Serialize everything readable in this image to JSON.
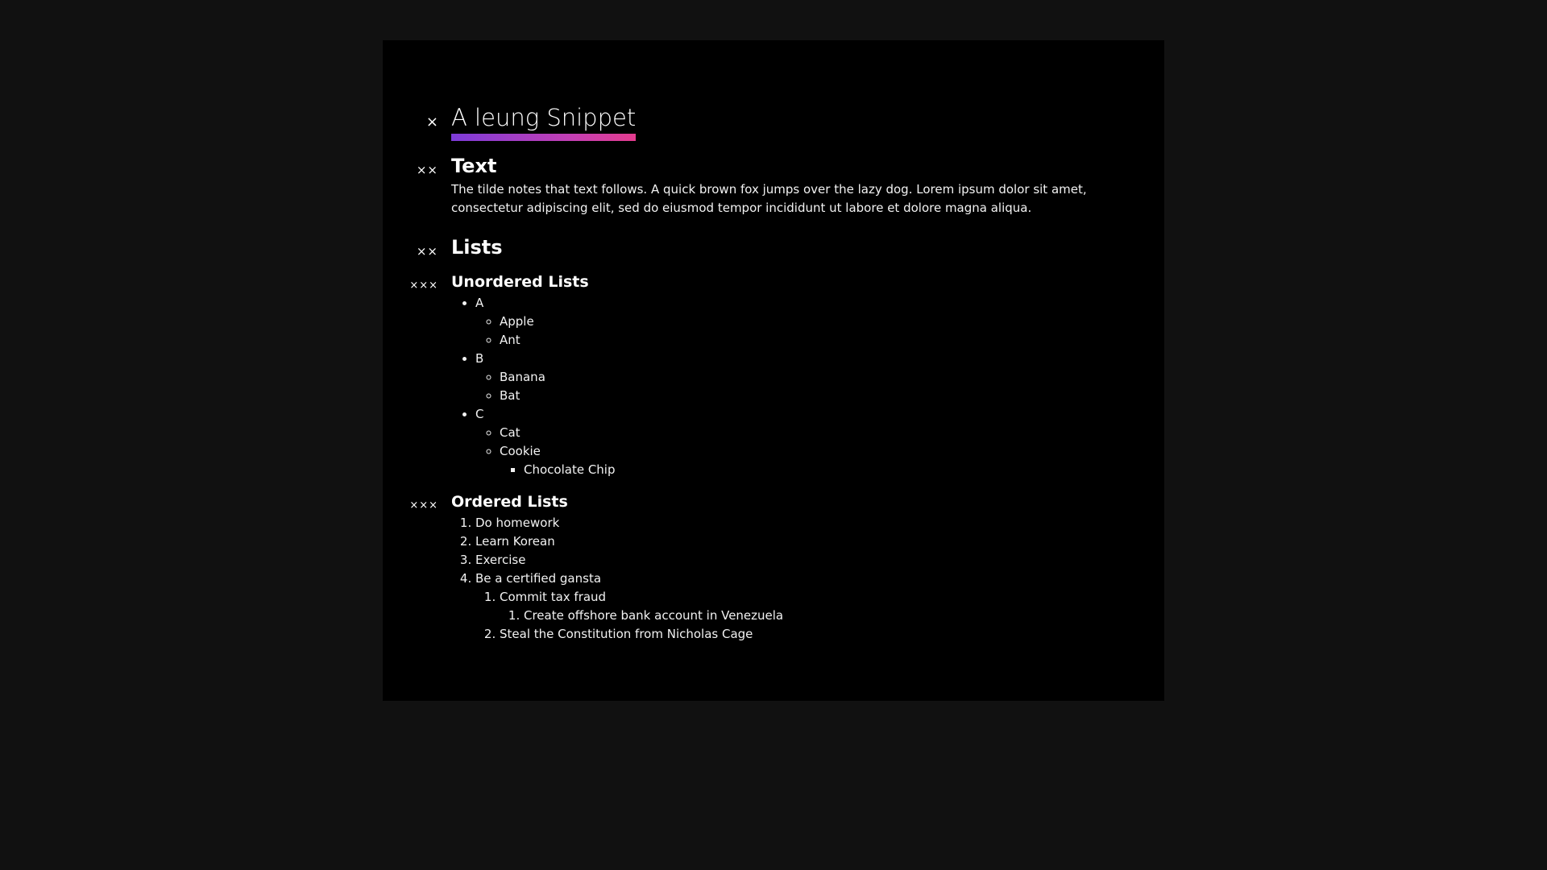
{
  "document": {
    "title": {
      "marker": "×",
      "text": "A leung Snippet"
    },
    "text_section": {
      "marker": "××",
      "heading": "Text",
      "paragraph": "The tilde notes that text follows. A quick brown fox jumps over the lazy dog. Lorem ipsum dolor sit amet, consectetur adipiscing elit, sed do eiusmod tempor incididunt ut labore et dolore magna aliqua."
    },
    "lists_section": {
      "marker": "××",
      "heading": "Lists",
      "unordered": {
        "marker": "×××",
        "heading": "Unordered Lists",
        "items": [
          {
            "label": "A",
            "children": [
              {
                "label": "Apple"
              },
              {
                "label": "Ant"
              }
            ]
          },
          {
            "label": "B",
            "children": [
              {
                "label": "Banana"
              },
              {
                "label": "Bat"
              }
            ]
          },
          {
            "label": "C",
            "children": [
              {
                "label": "Cat"
              },
              {
                "label": "Cookie",
                "children": [
                  {
                    "label": "Chocolate Chip"
                  }
                ]
              }
            ]
          }
        ]
      },
      "ordered": {
        "marker": "×××",
        "heading": "Ordered Lists",
        "items": [
          {
            "label": "Do homework"
          },
          {
            "label": "Learn Korean"
          },
          {
            "label": "Exercise"
          },
          {
            "label": "Be a certified gansta",
            "children": [
              {
                "label": "Commit tax fraud",
                "children": [
                  {
                    "label": "Create offshore bank account in Venezuela"
                  }
                ]
              },
              {
                "label": "Steal the Constitution from Nicholas Cage"
              }
            ]
          }
        ]
      }
    }
  },
  "colors": {
    "background": "#111111",
    "page": "#000000",
    "text": "#ffffff",
    "underline_start": "#7d3cd9",
    "underline_end": "#e43c8e"
  }
}
